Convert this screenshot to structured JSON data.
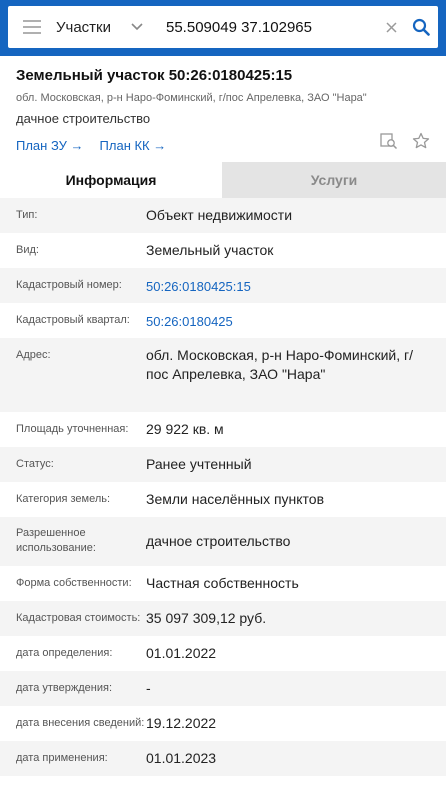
{
  "search": {
    "type_label": "Участки",
    "query": "55.509049 37.102965"
  },
  "parcel": {
    "title": "Земельный участок 50:26:0180425:15",
    "address": "обл. Московская, р-н Наро-Фоминский, г/пос Апрелевка, ЗАО \"Нара\"",
    "use": "дачное строительство",
    "links": [
      {
        "label": "План ЗУ →"
      },
      {
        "label": "План КК →"
      }
    ]
  },
  "tabs": {
    "info": "Информация",
    "services": "Услуги"
  },
  "rows": [
    {
      "key": "Тип:",
      "value": "Объект недвижимости"
    },
    {
      "key": "Вид:",
      "value": "Земельный участок"
    },
    {
      "key": "Кадастровый номер:",
      "value": "50:26:0180425:15"
    },
    {
      "key": "Кадастровый квартал:",
      "value": "50:26:0180425"
    },
    {
      "key": "Адрес:",
      "value": "обл. Московская, р-н Наро-Фоминский, г/пос Апрелевка, ЗАО \"Нара\""
    },
    {
      "key": "Площадь уточненная:",
      "value": "29 922 кв. м"
    },
    {
      "key": "Статус:",
      "value": "Ранее учтенный"
    },
    {
      "key": "Категория земель:",
      "value": "Земли населённых пунктов"
    },
    {
      "key": "Разрешенное использование:",
      "value": "дачное строительство"
    },
    {
      "key": "Форма собственности:",
      "value": "Частная собственность"
    },
    {
      "key": "Кадастровая стоимость:",
      "value": "35 097 309,12 руб."
    },
    {
      "key": "дата определения:",
      "value": "01.01.2022"
    },
    {
      "key": "дата утверждения:",
      "value": "-"
    },
    {
      "key": "дата внесения сведений:",
      "value": "19.12.2022"
    },
    {
      "key": "дата применения:",
      "value": "01.01.2023"
    }
  ],
  "colors": {
    "accent": "#1565c0",
    "row_alt": "#f4f4f4",
    "tab_inactive": "#e4e4e4"
  }
}
